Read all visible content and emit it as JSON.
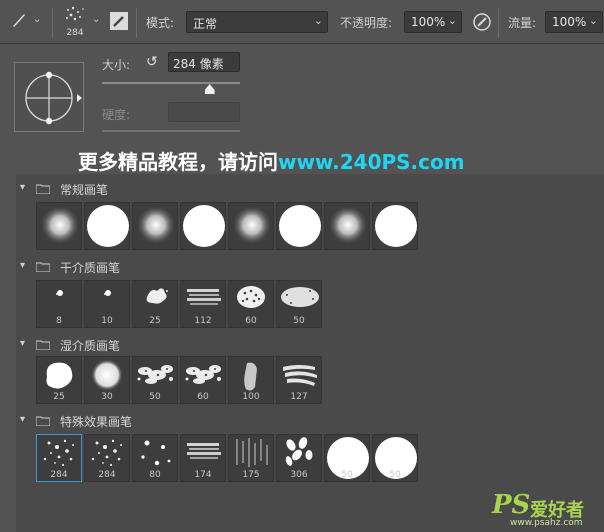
{
  "options_bar": {
    "brush_size": "284",
    "mode_label": "模式:",
    "mode_value": "正常",
    "opacity_label": "不透明度:",
    "opacity_value": "100%",
    "flow_label": "流量:",
    "flow_value": "100%"
  },
  "picker": {
    "size_label": "大小:",
    "size_value": "284 像素",
    "size_slider_fraction": 0.78,
    "hardness_label": "硬度:"
  },
  "watermark": {
    "chinese": "更多精品教程，请访问",
    "url": "www.240PS.com"
  },
  "groups": [
    {
      "name": "常规画笔",
      "brushes": [
        {
          "kind": "soft",
          "num": ""
        },
        {
          "kind": "hard",
          "num": ""
        },
        {
          "kind": "soft",
          "num": ""
        },
        {
          "kind": "hard",
          "num": ""
        },
        {
          "kind": "soft",
          "num": ""
        },
        {
          "kind": "hard",
          "num": ""
        },
        {
          "kind": "soft",
          "num": ""
        },
        {
          "kind": "hard",
          "num": ""
        }
      ]
    },
    {
      "name": "干介质画笔",
      "brushes": [
        {
          "kind": "dot-small",
          "num": "8"
        },
        {
          "kind": "dot-small",
          "num": "10"
        },
        {
          "kind": "splat",
          "num": "25"
        },
        {
          "kind": "chalk",
          "num": "112"
        },
        {
          "kind": "leafy",
          "num": "60"
        },
        {
          "kind": "spray",
          "num": "50"
        }
      ]
    },
    {
      "name": "湿介质画笔",
      "brushes": [
        {
          "kind": "blob",
          "num": "25"
        },
        {
          "kind": "cloud",
          "num": "30"
        },
        {
          "kind": "spatter",
          "num": "50"
        },
        {
          "kind": "spatter",
          "num": "60"
        },
        {
          "kind": "stroke",
          "num": "100"
        },
        {
          "kind": "streak",
          "num": "127"
        }
      ]
    },
    {
      "name": "特殊效果画笔",
      "brushes": [
        {
          "kind": "scatter",
          "num": "284",
          "selected": true
        },
        {
          "kind": "scatter",
          "num": "284"
        },
        {
          "kind": "dots",
          "num": "80"
        },
        {
          "kind": "chalk",
          "num": "174"
        },
        {
          "kind": "rain",
          "num": "175"
        },
        {
          "kind": "leaves",
          "num": "306"
        },
        {
          "kind": "hard",
          "num": "50"
        },
        {
          "kind": "hard",
          "num": "50"
        }
      ]
    }
  ],
  "logo": {
    "mark": "PS",
    "text": "爱好者",
    "site": "www.psahz.com"
  }
}
